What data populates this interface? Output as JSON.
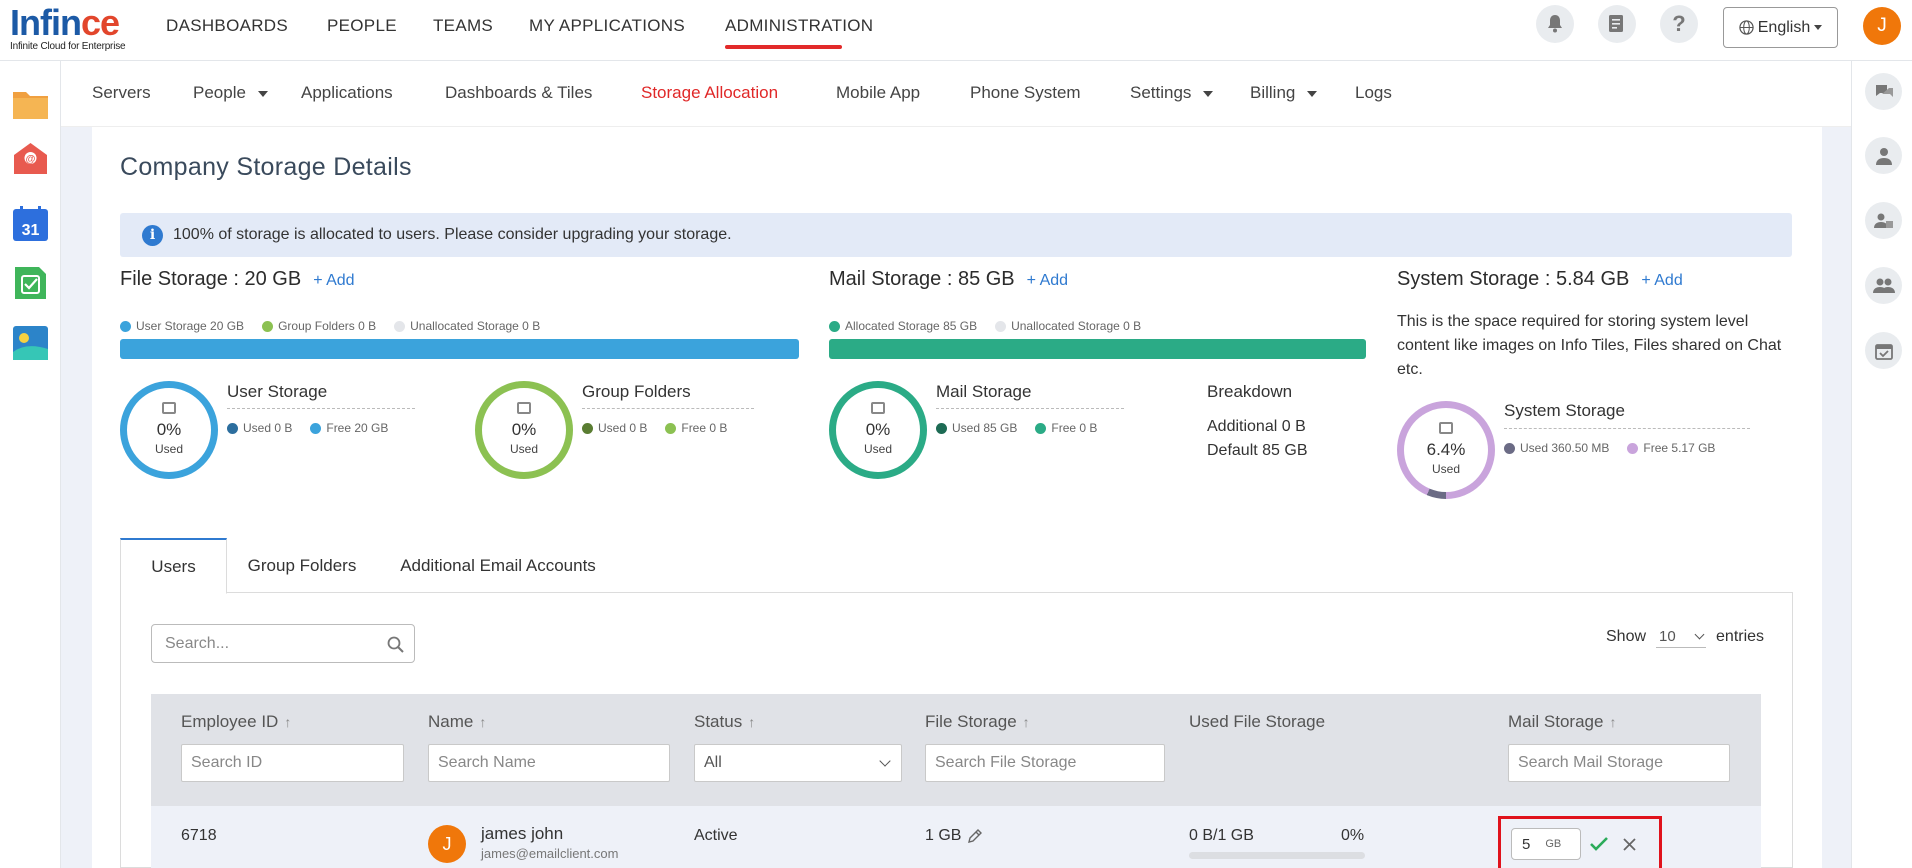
{
  "brand": {
    "part1": "Inf",
    "part2": "in",
    "part3": "ce",
    "tagline": "Infinite Cloud for Enterprise"
  },
  "topnav": [
    "DASHBOARDS",
    "PEOPLE",
    "TEAMS",
    "MY APPLICATIONS",
    "ADMINISTRATION"
  ],
  "topnav_active": "ADMINISTRATION",
  "header": {
    "language": "English",
    "user_initial": "J"
  },
  "subnav": [
    {
      "label": "Servers",
      "dropdown": false
    },
    {
      "label": "People",
      "dropdown": true
    },
    {
      "label": "Applications",
      "dropdown": false
    },
    {
      "label": "Dashboards & Tiles",
      "dropdown": false
    },
    {
      "label": "Storage Allocation",
      "dropdown": false
    },
    {
      "label": "Mobile App",
      "dropdown": false
    },
    {
      "label": "Phone System",
      "dropdown": false
    },
    {
      "label": "Settings",
      "dropdown": true
    },
    {
      "label": "Billing",
      "dropdown": true
    },
    {
      "label": "Logs",
      "dropdown": false
    }
  ],
  "subnav_active": "Storage Allocation",
  "page": {
    "title": "Company Storage Details",
    "alert": "100% of storage is allocated to users. Please consider upgrading your storage."
  },
  "file_storage": {
    "title": "File Storage : 20 GB",
    "add": "+ Add",
    "legend": [
      "User Storage 20 GB",
      "Group Folders 0 B",
      "Unallocated Storage 0 B"
    ],
    "user": {
      "title": "User Storage",
      "pct": "0%",
      "used_label": "Used",
      "used": "Used 0 B",
      "free": "Free 20 GB"
    },
    "group": {
      "title": "Group Folders",
      "pct": "0%",
      "used_label": "Used",
      "used": "Used 0 B",
      "free": "Free 0 B"
    }
  },
  "mail_storage": {
    "title": "Mail Storage : 85 GB",
    "add": "+ Add",
    "legend": [
      "Allocated Storage 85 GB",
      "Unallocated Storage 0 B"
    ],
    "mail": {
      "title": "Mail Storage",
      "pct": "0%",
      "used_label": "Used",
      "used": "Used 85 GB",
      "free": "Free 0 B"
    },
    "breakdown": {
      "title": "Breakdown",
      "additional": "Additional 0 B",
      "default": "Default 85 GB"
    }
  },
  "system_storage": {
    "title": "System Storage : 5.84 GB",
    "add": "+ Add",
    "description": "This is the space required for storing system level content like images on Info Tiles, Files shared on Chat etc.",
    "ring": {
      "title": "System Storage",
      "pct": "6.4%",
      "used_label": "Used",
      "used": "Used 360.50 MB",
      "free": "Free 5.17 GB",
      "fraction": 0.064
    }
  },
  "tabs": [
    "Users",
    "Group Folders",
    "Additional Email Accounts"
  ],
  "tabs_active": "Users",
  "table": {
    "search_placeholder": "Search...",
    "show_label": "Show",
    "show_value": "10",
    "entries_label": "entries",
    "headers": {
      "employee_id": "Employee ID",
      "name": "Name",
      "status": "Status",
      "file_storage": "File Storage",
      "used_file_storage": "Used File Storage",
      "mail_storage": "Mail Storage"
    },
    "filters": {
      "id": "Search ID",
      "name": "Search Name",
      "status": "All",
      "file_storage": "Search File Storage",
      "mail_storage": "Search Mail Storage"
    },
    "rows": [
      {
        "employee_id": "6718",
        "initial": "J",
        "name": "james john",
        "email": "james@emailclient.com",
        "status": "Active",
        "file_storage": "1 GB",
        "used_file_storage": "0 B/1 GB",
        "used_pct": "0%",
        "mail_value": "5",
        "mail_unit": "GB"
      }
    ]
  },
  "colors": {
    "accent_red": "#e22a2a",
    "link_blue": "#2f7ad0",
    "user_storage": "#3ba3dc",
    "group_folders": "#8cc152",
    "mail_green": "#2bab86",
    "system_purple": "#c9a4dc"
  }
}
